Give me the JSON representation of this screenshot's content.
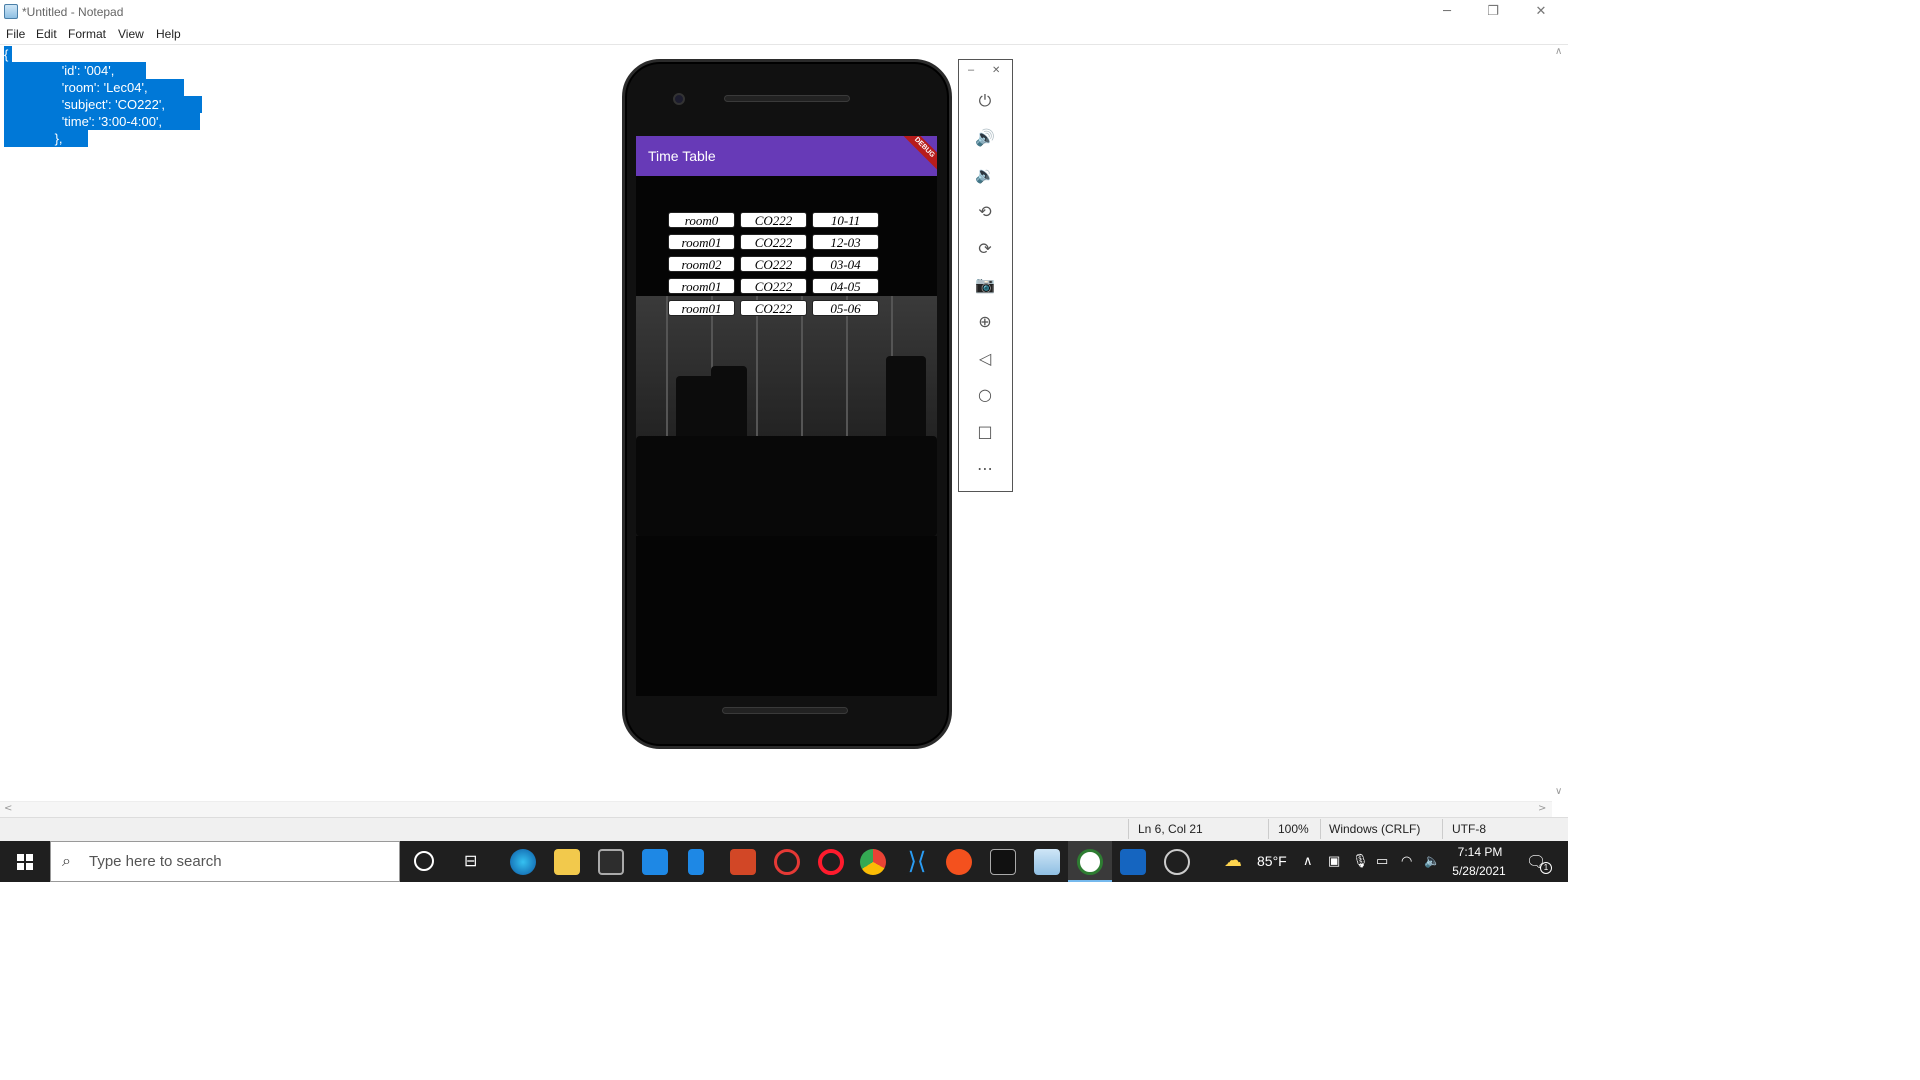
{
  "window": {
    "title": "*Untitled - Notepad"
  },
  "menu": [
    "File",
    "Edit",
    "Format",
    "View",
    "Help"
  ],
  "editor": {
    "lines": [
      "{",
      "                'id': '004',",
      "                'room': 'Lec04',",
      "                'subject': 'CO222',",
      "                'time': '3:00-4:00',",
      "              },"
    ]
  },
  "status": {
    "position": "Ln 6, Col 21",
    "zoom": "100%",
    "line_ending": "Windows (CRLF)",
    "encoding": "UTF-8"
  },
  "app": {
    "title": "Time Table",
    "debug_banner": "DEBUG",
    "rows": [
      {
        "room": "room0",
        "subject": "CO222",
        "time": "10-11"
      },
      {
        "room": "room01",
        "subject": "CO222",
        "time": "12-03"
      },
      {
        "room": "room02",
        "subject": "CO222",
        "time": "03-04"
      },
      {
        "room": "room01",
        "subject": "CO222",
        "time": "04-05"
      },
      {
        "room": "room01",
        "subject": "CO222",
        "time": "05-06"
      }
    ]
  },
  "taskbar": {
    "search_placeholder": "Type here to search",
    "weather": "85°F",
    "time": "7:14 PM",
    "date": "5/28/2021",
    "notification_count": "1"
  },
  "colors": {
    "accent": "#673ab7",
    "selection": "#0078d7",
    "taskbar": "#1f1f1f"
  }
}
